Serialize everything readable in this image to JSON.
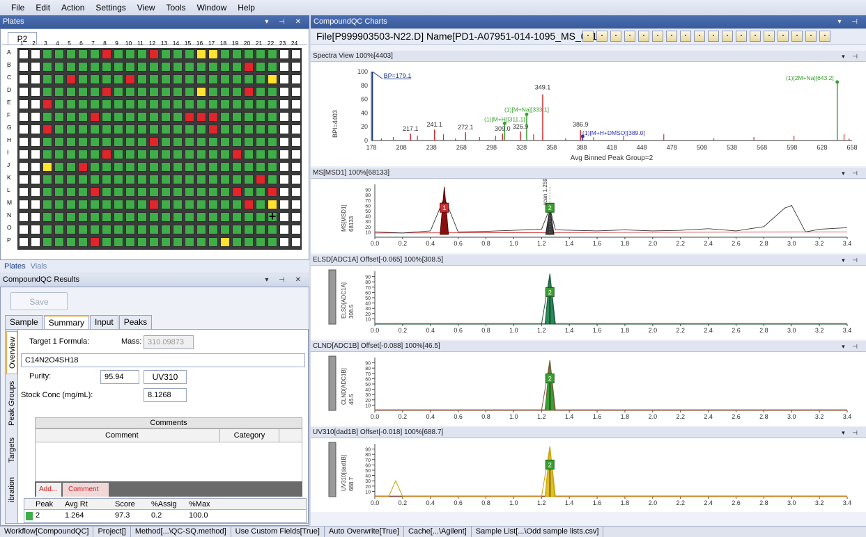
{
  "menu": [
    "File",
    "Edit",
    "Action",
    "Settings",
    "View",
    "Tools",
    "Window",
    "Help"
  ],
  "plates_panel": {
    "title": "Plates",
    "tab": "P2",
    "columns": [
      "1",
      "2",
      "3",
      "4",
      "5",
      "6",
      "7",
      "8",
      "9",
      "10",
      "11",
      "12",
      "13",
      "14",
      "15",
      "16",
      "17",
      "18",
      "19",
      "20",
      "21",
      "22",
      "23",
      "24"
    ],
    "rows": [
      "A",
      "B",
      "C",
      "D",
      "E",
      "F",
      "G",
      "H",
      "I",
      "J",
      "K",
      "L",
      "M",
      "N",
      "O",
      "P"
    ],
    "well_colors": {
      "empty": "#ffffff",
      "pass": "#3fae49",
      "fail": "#e0262a",
      "warn": "#ffe32e"
    },
    "well_status_rows": [
      "EEPPPPPFPPPFPPPWWPPPPPEE",
      "EEPPPPPPPPPPPPPPPPPFPPEE",
      "EEPPFPPPPFPPPPPPPPPPPWEE",
      "EEPPPPPFPPPPPPPWPPPFPPEE",
      "EEFPPPPPPPPPPPPPPPPPPPEE",
      "EEPPPPFPPPPPPPFFFPPPPPEE",
      "EEFPPPPPPPPPPPPPFPPPPPEE",
      "EEPPPPPPPPPFPPPPPPPPPPEE",
      "EEPPPPPFPPPPPPPPPPFPPPEE",
      "EEWPPFPPPPPPPPPPPPPPPPEE",
      "EEPPPPPPPPPPPPPPPPPPFPEE",
      "EEPPPPFPPPPPPPPPPPFPPFEE",
      "EEPPPPPPPPPFPPPPPPPFPWEE",
      "EEPPPPPPPPPPPPPPPPPPPPEE",
      "EEPPPPPPPPPPPPPPPPPPPPEE",
      "EEPPPPFPPPPPPPPPPWPPPPEE"
    ],
    "selected_well": "N22",
    "bottom_tabs": {
      "plates": "Plates",
      "vials": "Vials"
    }
  },
  "results_panel": {
    "title": "CompoundQC Results",
    "save_label": "Save",
    "tabs": [
      "Sample",
      "Summary",
      "Input",
      "Peaks"
    ],
    "active_tab": "Summary",
    "side_tabs": [
      "Overview",
      "Peak Groups",
      "Targets",
      "ibration"
    ],
    "target_formula_label": "Target 1 Formula:",
    "mass_label": "Mass:",
    "mass_value": "310.09873",
    "formula_value": "C14N2O4SH18",
    "purity_label": "Purity:",
    "purity_value": "95.94",
    "purity_detector": "UV310",
    "stock_label": "Stock Conc (mg/mL):",
    "stock_value": "8.1268",
    "comments_header": "Comments",
    "comment_col": "Comment",
    "category_col": "Category",
    "add_label": "Add...",
    "comment_button": "Comment",
    "peaks_columns": [
      "Peak",
      "Avg Rt",
      "Score",
      "%Assig",
      "%Max"
    ],
    "peaks_rows": [
      {
        "peak": "2",
        "avg_rt": "1.264",
        "score": "97.3",
        "assig": "0.2",
        "max": "100.0",
        "color": "#3fae49"
      }
    ]
  },
  "charts_panel": {
    "title": "CompoundQC Charts",
    "file_label": "File[P999903503-N22.D] Name[PD1-A07951-014-1095_MS_001]",
    "toolbar_icons": [
      "bar-icon",
      "table-icon",
      "spectrum-icon",
      "list-icon",
      "zoom-icon",
      "filter-icon",
      "label-a-icon",
      "label-b-icon",
      "bars-icon",
      "bars-alt-icon",
      "peak-icon",
      "peak-marker-icon",
      "peak-pair-icon",
      "peak-box-icon",
      "ec-icon",
      "export-icon",
      "view-icon",
      "layout-icon"
    ]
  },
  "spectra": {
    "title": "Spectra View 100%[4403]",
    "y_title": "BPI=4403",
    "x_title": "Avg Binned Peak Group=2",
    "bp_label": "BP=179.1",
    "x_ticks": [
      "178",
      "208",
      "238",
      "268",
      "298",
      "328",
      "358",
      "388",
      "418",
      "448",
      "478",
      "508",
      "538",
      "568",
      "598",
      "628",
      "658"
    ],
    "y_ticks": [
      "0",
      "20",
      "40",
      "60",
      "80",
      "100"
    ],
    "peak_labels": [
      "349.1",
      "241.1",
      "217.1",
      "272.1",
      "309.0",
      "326.9",
      "386.9"
    ],
    "annotations": [
      "(1)[M+Na][333.1]",
      "(1)[M+H][311.1]",
      "(1)[M+H+DMSO][389.0]",
      "(1)[2M+Na][643.2]"
    ]
  },
  "chart_data": [
    {
      "type": "bar",
      "title": "Spectra View 100%[4403]",
      "xlabel": "Avg Binned Peak Group=2",
      "ylabel": "BPI=4403",
      "xlim": [
        178,
        658
      ],
      "ylim": [
        0,
        100
      ],
      "peaks": [
        {
          "x": 179.1,
          "y": 100
        },
        {
          "x": 217.1,
          "y": 10
        },
        {
          "x": 241.1,
          "y": 16
        },
        {
          "x": 272.1,
          "y": 12
        },
        {
          "x": 309.0,
          "y": 10
        },
        {
          "x": 311.1,
          "y": 25
        },
        {
          "x": 326.9,
          "y": 13
        },
        {
          "x": 333.1,
          "y": 38
        },
        {
          "x": 349.1,
          "y": 67
        },
        {
          "x": 386.9,
          "y": 15
        },
        {
          "x": 389.0,
          "y": 5
        },
        {
          "x": 643.2,
          "y": 85
        }
      ]
    },
    {
      "type": "line",
      "title": "MS[MSD1]  100%[68133]",
      "ylabel": "MS[MSD1] 68133",
      "xlim": [
        0.0,
        3.4
      ],
      "ylim": [
        0,
        100
      ],
      "series": [
        {
          "name": "MS",
          "x": [
            0.0,
            0.2,
            0.4,
            0.5,
            0.6,
            0.8,
            1.0,
            1.2,
            1.26,
            1.3,
            1.6,
            1.8,
            2.0,
            2.2,
            2.4,
            2.6,
            2.8,
            2.95,
            3.0,
            3.1,
            3.2,
            3.4
          ],
          "y": [
            10,
            8,
            12,
            75,
            10,
            11,
            13,
            15,
            55,
            14,
            12,
            14,
            12,
            13,
            16,
            12,
            20,
            55,
            60,
            10,
            15,
            18
          ]
        }
      ]
    },
    {
      "type": "line",
      "title": "ELSD[ADC1A] Offset[-0.065]  100%[308.5]",
      "ylabel": "ELSD[ADC1A] 308.5",
      "xlim": [
        0.0,
        3.4
      ],
      "ylim": [
        0,
        100
      ],
      "series": [
        {
          "name": "ELSD",
          "x": [
            0.0,
            1.2,
            1.26,
            1.3,
            3.4
          ],
          "y": [
            0,
            0,
            95,
            0,
            0
          ]
        }
      ]
    },
    {
      "type": "line",
      "title": "CLND[ADC1B] Offset[-0.088]  100%[46.5]",
      "ylabel": "CLND[ADC1B] 46.5",
      "xlim": [
        0.0,
        3.4
      ],
      "ylim": [
        0,
        100
      ],
      "series": [
        {
          "name": "CLND",
          "x": [
            0.0,
            1.2,
            1.26,
            1.3,
            3.4
          ],
          "y": [
            0,
            0,
            95,
            0,
            0
          ]
        }
      ]
    },
    {
      "type": "line",
      "title": "UV310[dad1B] Offset[-0.018]  100%[688.7]",
      "ylabel": "UV310[dad1B] 688.7",
      "xlim": [
        0.0,
        3.4
      ],
      "ylim": [
        0,
        100
      ],
      "series": [
        {
          "name": "UV310",
          "x": [
            0.0,
            0.1,
            0.15,
            0.2,
            1.2,
            1.26,
            1.3,
            3.4
          ],
          "y": [
            0,
            0,
            30,
            0,
            0,
            95,
            0,
            0
          ]
        }
      ]
    }
  ],
  "ms": {
    "title": "MS[MSD1]  100%[68133]",
    "y_label": "MS[MSD1]",
    "y_value": "68133",
    "scan_label": "scan 1.259",
    "peak_boxes": [
      "1",
      "2"
    ]
  },
  "elsd": {
    "title": "ELSD[ADC1A] Offset[-0.065]  100%[308.5]",
    "y_label": "ELSD[ADC1A]",
    "y_value": "308.5",
    "peak_box": "2"
  },
  "clnd": {
    "title": "CLND[ADC1B] Offset[-0.088]  100%[46.5]",
    "y_label": "CLND[ADC1B]",
    "y_value": "46.5",
    "peak_box": "2"
  },
  "uv": {
    "title": "UV310[dad1B] Offset[-0.018]  100%[688.7]",
    "y_label": "UV310[dad1B]",
    "y_value": "688.7",
    "peak_box": "2"
  },
  "trace_x_ticks": [
    "0.0",
    "0.2",
    "0.4",
    "0.6",
    "0.8",
    "1.0",
    "1.2",
    "1.4",
    "1.6",
    "1.8",
    "2.0",
    "2.2",
    "2.4",
    "2.6",
    "2.8",
    "3.0",
    "3.2",
    "3.4"
  ],
  "trace_y_ticks": [
    "10",
    "20",
    "30",
    "40",
    "50",
    "60",
    "70",
    "80",
    "90"
  ],
  "statusbar": [
    "Workflow[CompoundQC]",
    "Project[]",
    "Method[...\\QC-SQ.method]",
    "Use Custom Fields[True]",
    "Auto Overwrite[True]",
    "Cache[...\\Agilent]",
    "Sample List[...\\Odd sample lists.csv]"
  ]
}
